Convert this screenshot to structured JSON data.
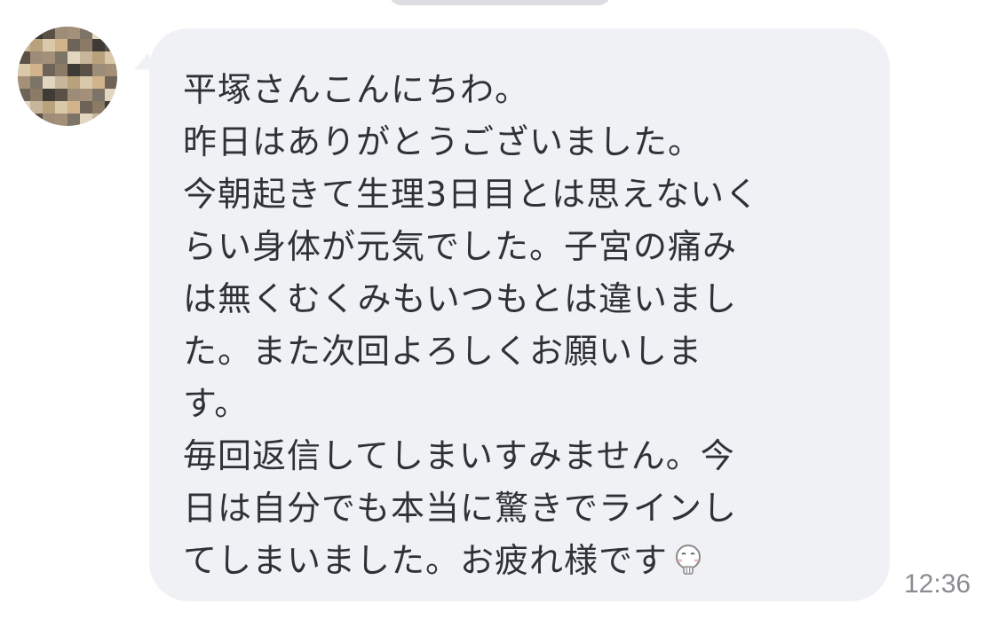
{
  "message": {
    "lines": [
      "平塚さんこんにちわ。",
      "昨日はありがとうございました。",
      "今朝起きて生理3日目とは思えないく",
      "らい身体が元気でした。子宮の痛み",
      "は無くむくみもいつもとは違いまし",
      "た。また次回よろしくお願いしま",
      "す。",
      "毎回返信してしまいすみません。今",
      "日は自分でも本当に驚きでラインし",
      "てしまいました。お疲れ様です"
    ],
    "emoji_icon": "crying-face-icon",
    "timestamp": "12:36"
  },
  "colors": {
    "bubble_background": "#f0f1f4",
    "text": "#2e3138",
    "timestamp": "#8a8c91",
    "top_pill": "#dcdde1"
  }
}
